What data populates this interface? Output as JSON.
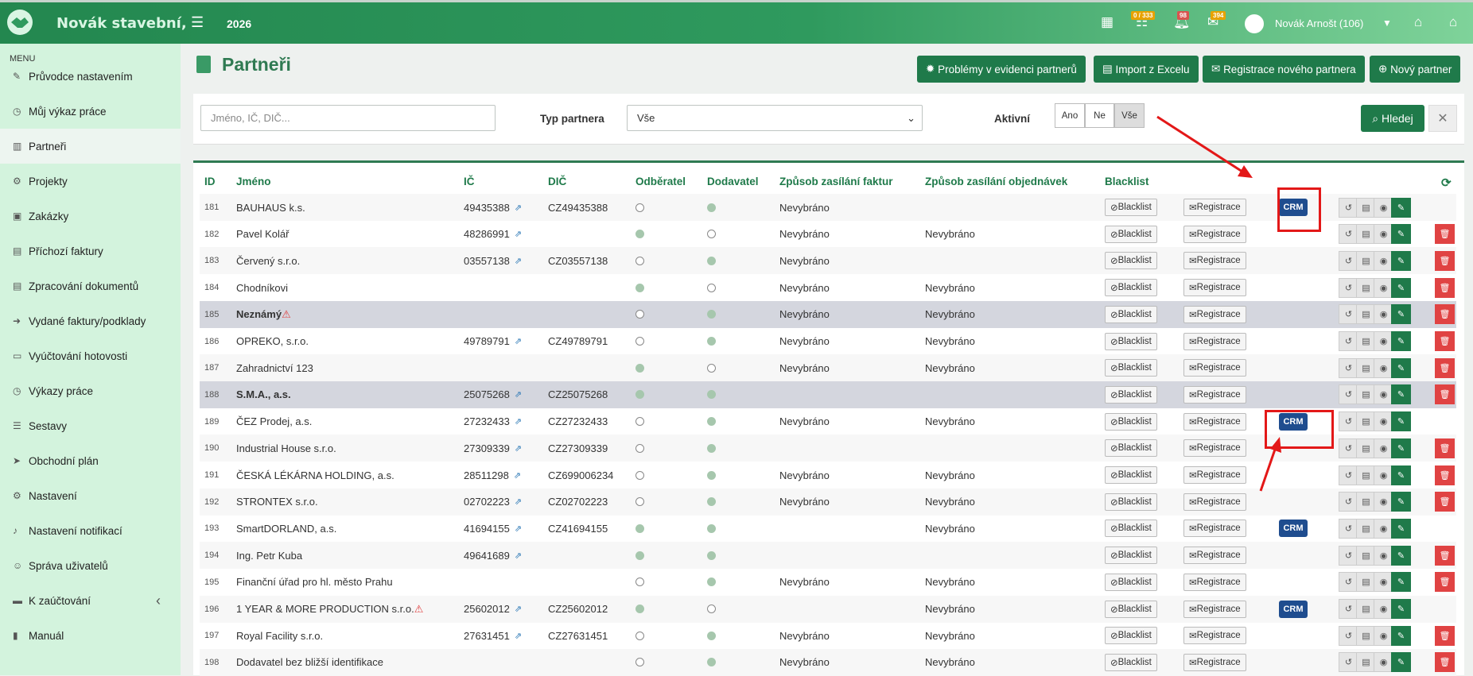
{
  "app": {
    "brand": "Novák stavební,",
    "year": "2026",
    "user": "Novák Arnošt (106)"
  },
  "badges": {
    "tasks": "0 / 333",
    "notifications": "98",
    "messages": "394"
  },
  "sidebar": {
    "heading": "MENU",
    "items": [
      {
        "label": "Průvodce nastavením",
        "icon": "pencil-icon"
      },
      {
        "label": "Můj výkaz práce",
        "icon": "clock-icon"
      },
      {
        "label": "Partneři",
        "icon": "building-icon",
        "active": true
      },
      {
        "label": "Projekty",
        "icon": "sitemap-icon"
      },
      {
        "label": "Zakázky",
        "icon": "box-icon"
      },
      {
        "label": "Příchozí faktury",
        "icon": "file-icon"
      },
      {
        "label": "Zpracování dokumentů",
        "icon": "file-icon"
      },
      {
        "label": "Vydané faktury/podklady",
        "icon": "file-export-icon"
      },
      {
        "label": "Vyúčtování hotovosti",
        "icon": "money-icon"
      },
      {
        "label": "Výkazy práce",
        "icon": "clock-icon"
      },
      {
        "label": "Sestavy",
        "icon": "list-icon"
      },
      {
        "label": "Obchodní plán",
        "icon": "send-icon"
      },
      {
        "label": "Nastavení",
        "icon": "gears-icon"
      },
      {
        "label": "Nastavení notifikací",
        "icon": "bell-icon"
      },
      {
        "label": "Správa uživatelů",
        "icon": "users-icon"
      },
      {
        "label": "K zaúčtování",
        "icon": "folder-icon"
      },
      {
        "label": "Manuál",
        "icon": "book-icon"
      }
    ]
  },
  "page": {
    "title": "Partneři"
  },
  "toolbar": {
    "problems": "Problémy v evidenci partnerů",
    "import": "Import z Excelu",
    "register": "Registrace nového partnera",
    "new": "Nový partner"
  },
  "filter": {
    "search_placeholder": "Jméno, IČ, DIČ...",
    "type_label": "Typ partnera",
    "type_value": "Vše",
    "active_label": "Aktivní",
    "active_options": [
      "Ano",
      "Ne",
      "Vše"
    ],
    "search_btn": "Hledej"
  },
  "table": {
    "columns": [
      "ID",
      "Jméno",
      "IČ",
      "DIČ",
      "Odběratel",
      "Dodavatel",
      "Způsob zasílání faktur",
      "Způsob zasílání objednávek",
      "Blacklist"
    ],
    "blacklist_label": "Blacklist",
    "registrace_label": "Registrace",
    "crm_label": "CRM",
    "rows": [
      {
        "id": "181",
        "name": "BAUHAUS k.s.",
        "ic": "49435388",
        "dic": "CZ49435388",
        "odb": false,
        "dod": true,
        "fakt": "Nevybráno",
        "obj": "",
        "crm": true,
        "del": false,
        "style": "alt"
      },
      {
        "id": "182",
        "name": "Pavel Kolář",
        "ic": "48286991",
        "dic": "",
        "odb": true,
        "dod": false,
        "fakt": "Nevybráno",
        "obj": "Nevybráno",
        "crm": false,
        "del": true,
        "style": ""
      },
      {
        "id": "183",
        "name": "Červený s.r.o.",
        "ic": "03557138",
        "dic": "CZ03557138",
        "odb": false,
        "dod": true,
        "fakt": "Nevybráno",
        "obj": "",
        "crm": false,
        "del": true,
        "style": "alt"
      },
      {
        "id": "184",
        "name": "Chodníkovi",
        "ic": "",
        "dic": "",
        "odb": true,
        "dod": false,
        "fakt": "Nevybráno",
        "obj": "Nevybráno",
        "crm": false,
        "del": true,
        "style": ""
      },
      {
        "id": "185",
        "name": "Neznámý",
        "warn": true,
        "ic": "",
        "dic": "",
        "odb": false,
        "dod": true,
        "fakt": "Nevybráno",
        "obj": "Nevybráno",
        "crm": false,
        "del": true,
        "style": "hl"
      },
      {
        "id": "186",
        "name": "OPREKO, s.r.o.",
        "ic": "49789791",
        "dic": "CZ49789791",
        "odb": false,
        "dod": true,
        "fakt": "Nevybráno",
        "obj": "Nevybráno",
        "crm": false,
        "del": true,
        "style": ""
      },
      {
        "id": "187",
        "name": "Zahradnictví 123",
        "ic": "",
        "dic": "",
        "odb": true,
        "dod": false,
        "fakt": "Nevybráno",
        "obj": "Nevybráno",
        "crm": false,
        "del": true,
        "style": "alt"
      },
      {
        "id": "188",
        "name": "S.M.A., a.s.",
        "ic": "25075268",
        "dic": "CZ25075268",
        "odb": true,
        "dod": true,
        "fakt": "",
        "obj": "",
        "crm": false,
        "del": true,
        "style": "hl"
      },
      {
        "id": "189",
        "name": "ČEZ Prodej, a.s.",
        "ic": "27232433",
        "dic": "CZ27232433",
        "odb": false,
        "dod": true,
        "fakt": "Nevybráno",
        "obj": "Nevybráno",
        "crm": true,
        "del": false,
        "style": ""
      },
      {
        "id": "190",
        "name": "Industrial House s.r.o.",
        "ic": "27309339",
        "dic": "CZ27309339",
        "odb": false,
        "dod": true,
        "fakt": "",
        "obj": "",
        "crm": false,
        "del": true,
        "style": "alt"
      },
      {
        "id": "191",
        "name": "ČESKÁ LÉKÁRNA HOLDING, a.s.",
        "ic": "28511298",
        "dic": "CZ699006234",
        "odb": false,
        "dod": true,
        "fakt": "Nevybráno",
        "obj": "Nevybráno",
        "crm": false,
        "del": true,
        "style": ""
      },
      {
        "id": "192",
        "name": "STRONTEX s.r.o.",
        "ic": "02702223",
        "dic": "CZ02702223",
        "odb": false,
        "dod": true,
        "fakt": "Nevybráno",
        "obj": "Nevybráno",
        "crm": false,
        "del": true,
        "style": "alt"
      },
      {
        "id": "193",
        "name": "SmartDORLAND, a.s.",
        "ic": "41694155",
        "dic": "CZ41694155",
        "odb": true,
        "dod": true,
        "fakt": "",
        "obj": "Nevybráno",
        "crm": true,
        "del": false,
        "style": ""
      },
      {
        "id": "194",
        "name": "Ing. Petr Kuba",
        "ic": "49641689",
        "dic": "",
        "odb": true,
        "dod": true,
        "fakt": "",
        "obj": "",
        "crm": false,
        "del": true,
        "style": "alt"
      },
      {
        "id": "195",
        "name": "Finanční úřad pro hl. město Prahu",
        "ic": "",
        "dic": "",
        "odb": false,
        "dod": true,
        "fakt": "Nevybráno",
        "obj": "Nevybráno",
        "crm": false,
        "del": true,
        "style": ""
      },
      {
        "id": "196",
        "name": "1 YEAR & MORE PRODUCTION s.r.o.",
        "warn": true,
        "ic": "25602012",
        "dic": "CZ25602012",
        "odb": true,
        "dod": false,
        "fakt": "",
        "obj": "Nevybráno",
        "crm": true,
        "del": false,
        "style": "alt"
      },
      {
        "id": "197",
        "name": "Royal Facility s.r.o.",
        "ic": "27631451",
        "dic": "CZ27631451",
        "odb": false,
        "dod": true,
        "fakt": "Nevybráno",
        "obj": "Nevybráno",
        "crm": false,
        "del": true,
        "style": ""
      },
      {
        "id": "198",
        "name": "Dodavatel bez bližší identifikace",
        "ic": "",
        "dic": "",
        "odb": false,
        "dod": true,
        "fakt": "Nevybráno",
        "obj": "Nevybráno",
        "crm": false,
        "del": true,
        "style": "alt"
      }
    ]
  },
  "colors": {
    "primary": "#1f7a4a",
    "crm": "#1f4d8f",
    "delete": "#e04343",
    "annotation": "#e31818"
  }
}
